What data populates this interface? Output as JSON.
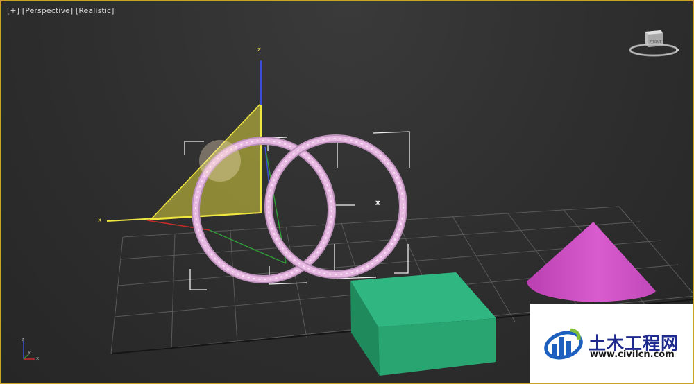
{
  "viewport": {
    "menu_label": "[+]",
    "view_label": "[Perspective]",
    "shading_label": "[Realistic]"
  },
  "gizmo": {
    "x": "x",
    "z": "z"
  },
  "viewcube": {
    "face_label": "FRONT"
  },
  "mini_axes": {
    "x": "x",
    "y": "y",
    "z": "z"
  },
  "colors": {
    "viewport_border": "#c9a227",
    "torus": "#e7b9e2",
    "box": "#2aab78",
    "cone": "#d65fcc",
    "plane": "#d9d23a"
  },
  "watermark": {
    "chinese": "土木工程网",
    "url": "www.civilcn.com"
  }
}
